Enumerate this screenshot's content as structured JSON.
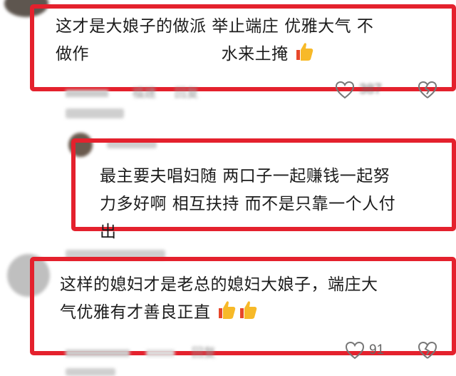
{
  "comments": [
    {
      "text_line1": "这才是大娘子的做派  举止端庄    优雅大气 不",
      "text_line2_a": "做作",
      "text_line2_b": "水来土掩",
      "emoji": "thumbs-up",
      "meta_region": "福建",
      "meta_reply": "回复",
      "like_count": "387"
    },
    {
      "text_line1": "最主要夫唱妇随 两口子一起赚钱一起努",
      "text_line2": "力多好啊 相互扶持 而不是只靠一个人付",
      "text_line3": "出"
    },
    {
      "text_line1": "这样的媳妇才是老总的媳妇大娘子，端庄大",
      "text_line2": "气优雅有才善良正直",
      "emoji": "thumbs-up",
      "meta_reply": "回复",
      "like_count": "91"
    }
  ],
  "colors": {
    "highlight_border": "#e4212d",
    "thumb_yellow": "#f7b928",
    "thumb_orange": "#e7472a"
  },
  "icons": [
    "avatar",
    "heart-icon",
    "dislike-icon",
    "thumbs-up-icon"
  ]
}
